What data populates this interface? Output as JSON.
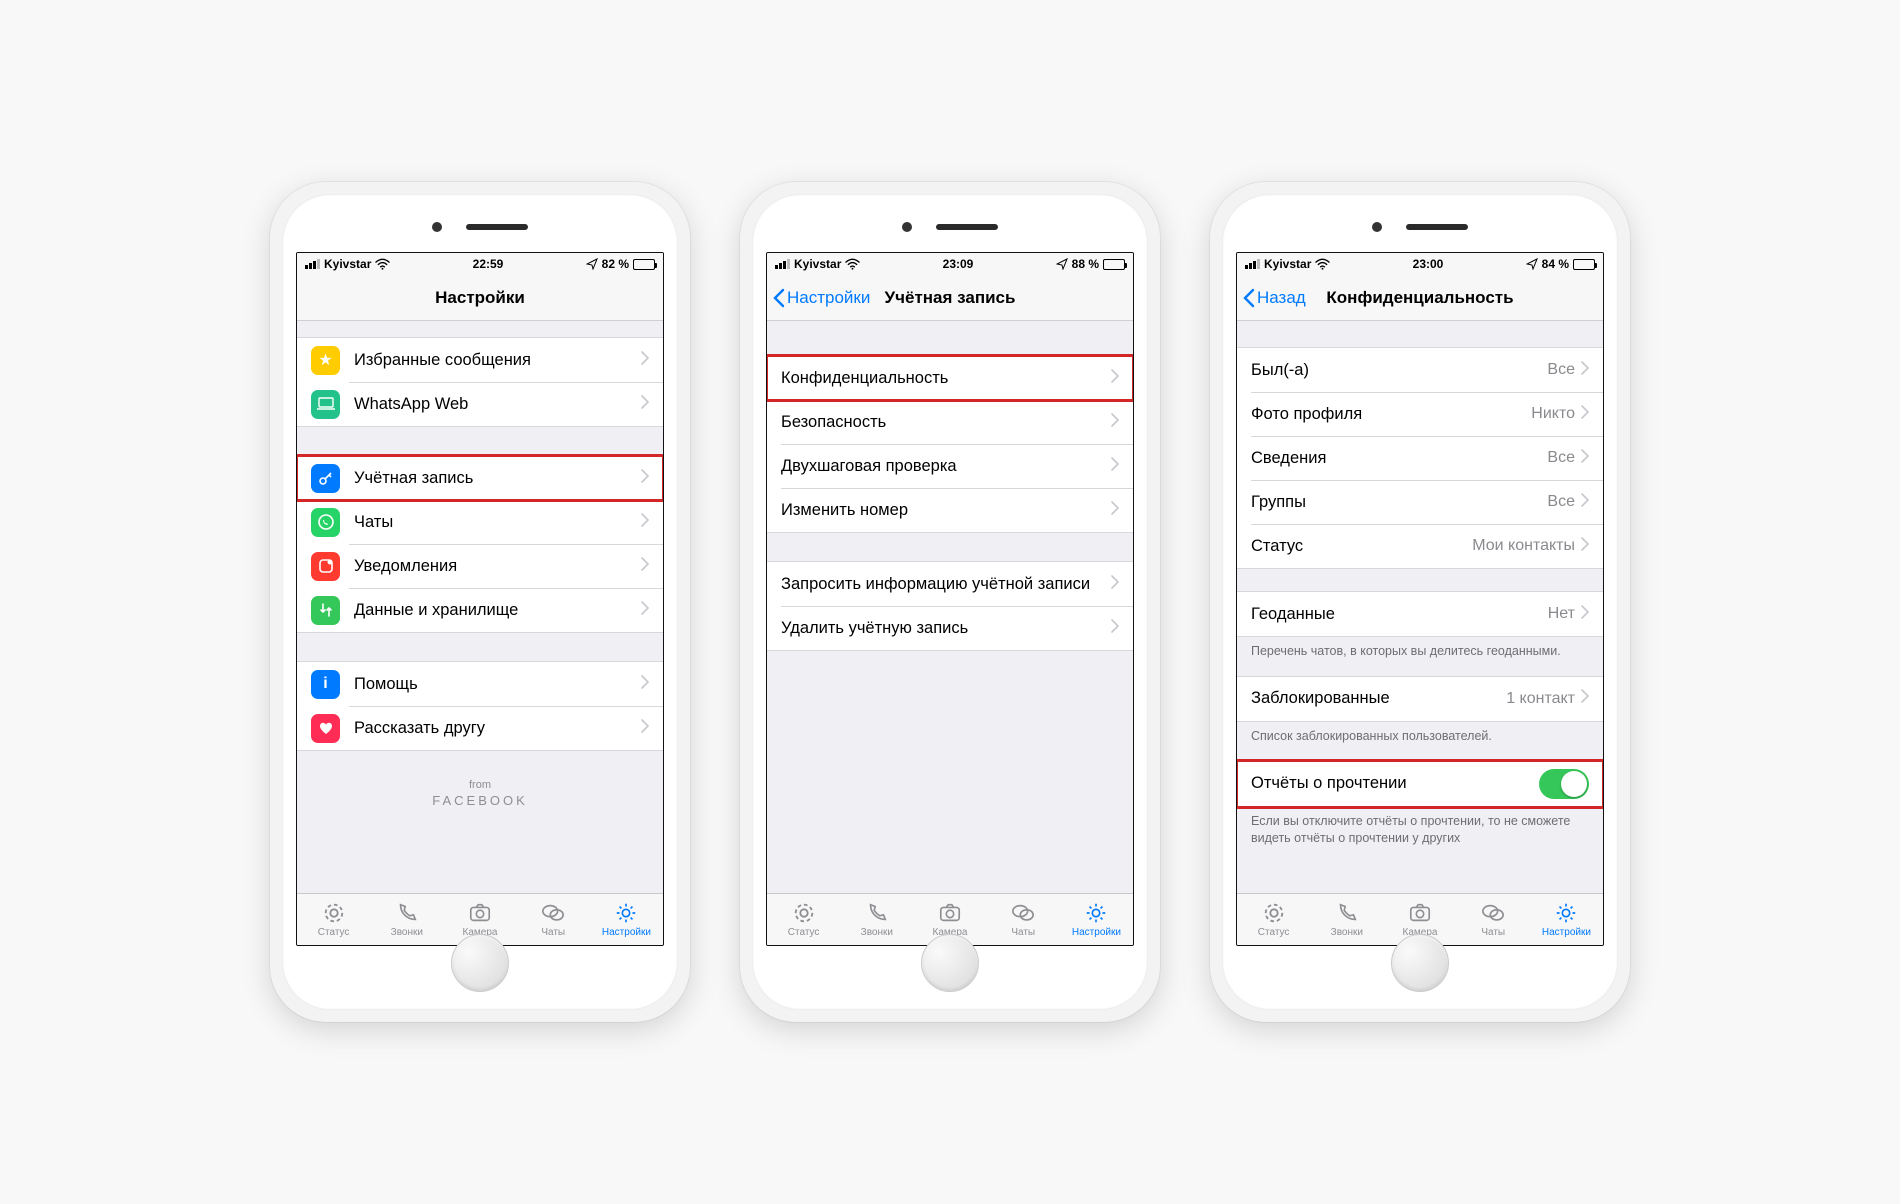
{
  "tabbar": {
    "status": "Статус",
    "calls": "Звонки",
    "camera": "Камера",
    "chats": "Чаты",
    "settings": "Настройки"
  },
  "phone1": {
    "carrier": "Kyivstar",
    "time": "22:59",
    "battery": "82 %",
    "title": "Настройки",
    "starred": "Избранные сообщения",
    "web": "WhatsApp Web",
    "account": "Учётная запись",
    "chats": "Чаты",
    "notif": "Уведомления",
    "storage": "Данные и хранилище",
    "help": "Помощь",
    "tell": "Рассказать другу",
    "from": "from",
    "fb": "FACEBOOK"
  },
  "phone2": {
    "carrier": "Kyivstar",
    "time": "23:09",
    "battery": "88 %",
    "back": "Настройки",
    "title": "Учётная запись",
    "privacy": "Конфиденциальность",
    "security": "Безопасность",
    "twostep": "Двухшаговая проверка",
    "changenum": "Изменить номер",
    "request": "Запросить информацию учётной записи",
    "delete": "Удалить учётную запись"
  },
  "phone3": {
    "carrier": "Kyivstar",
    "time": "23:00",
    "battery": "84 %",
    "back": "Назад",
    "title": "Конфиденциальность",
    "lastseen": "Был(-а)",
    "lastseen_v": "Все",
    "photo": "Фото профиля",
    "photo_v": "Никто",
    "about": "Сведения",
    "about_v": "Все",
    "groups": "Группы",
    "groups_v": "Все",
    "status": "Статус",
    "status_v": "Мои контакты",
    "geo": "Геоданные",
    "geo_v": "Нет",
    "geo_note": "Перечень чатов, в которых вы делитесь геоданными.",
    "blocked": "Заблокированные",
    "blocked_v": "1 контакт",
    "blocked_note": "Список заблокированных пользователей.",
    "read": "Отчёты о прочтении",
    "read_note": "Если вы отключите отчёты о прочтении, то не сможете видеть отчёты о прочтении у других"
  }
}
